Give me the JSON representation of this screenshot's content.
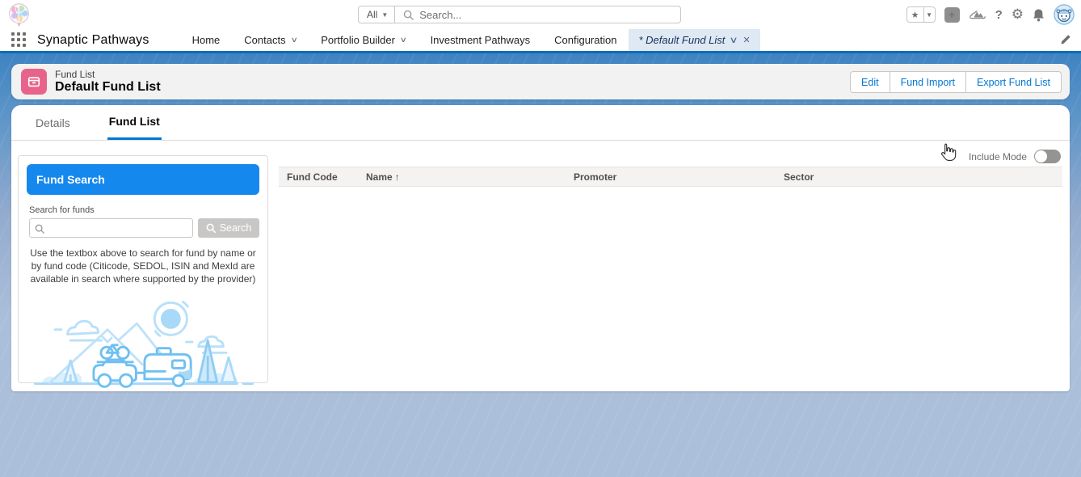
{
  "app": {
    "name": "Synaptic Pathways"
  },
  "global_header": {
    "search_scope": "All",
    "search_placeholder": "Search...",
    "icons": {
      "favorites": "star-icon",
      "global_actions": "plus-icon",
      "trailhead": "mountain-icon",
      "help": "question-icon",
      "setup": "gear-icon",
      "notifications": "bell-icon",
      "profile": "astro-avatar"
    }
  },
  "nav": {
    "tabs": [
      {
        "label": "Home",
        "dropdown": false,
        "active": false
      },
      {
        "label": "Contacts",
        "dropdown": true,
        "active": false
      },
      {
        "label": "Portfolio Builder",
        "dropdown": true,
        "active": false
      },
      {
        "label": "Investment Pathways",
        "dropdown": false,
        "active": false
      },
      {
        "label": "Configuration",
        "dropdown": false,
        "active": false
      },
      {
        "label": "* Default Fund List",
        "dropdown": true,
        "active": true,
        "closable": true
      }
    ]
  },
  "page_header": {
    "record_type": "Fund List",
    "title": "Default Fund List",
    "actions": [
      {
        "label": "Edit"
      },
      {
        "label": "Fund Import"
      },
      {
        "label": "Export Fund List"
      }
    ]
  },
  "content_tabs": [
    {
      "label": "Details",
      "active": false
    },
    {
      "label": "Fund List",
      "active": true
    }
  ],
  "fund_search": {
    "panel_title": "Fund Search",
    "input_label": "Search for funds",
    "input_value": "",
    "search_button_label": "Search",
    "help_text": "Use the textbox above to search for fund by name or by fund code (Citicode, SEDOL, ISIN and MexId are available in search where supported by the provider)"
  },
  "fund_table": {
    "include_mode_label": "Include Mode",
    "include_mode_enabled": false,
    "columns": [
      {
        "label": "Fund Code",
        "sorted": null
      },
      {
        "label": "Name",
        "sorted": "asc",
        "sort_glyph": "↑"
      },
      {
        "label": "Promoter",
        "sorted": null
      },
      {
        "label": "Sector",
        "sorted": null
      }
    ],
    "rows": []
  },
  "colors": {
    "brand_blue": "#0176d3",
    "panel_header_blue": "#1588ee",
    "record_icon_pink": "#e8638c",
    "band_top_blue": "#3e83c2",
    "canvas_bottom_blue": "#abbfda",
    "header_card_gray": "#f3f2f2",
    "toggle_off_gray": "#969492"
  }
}
